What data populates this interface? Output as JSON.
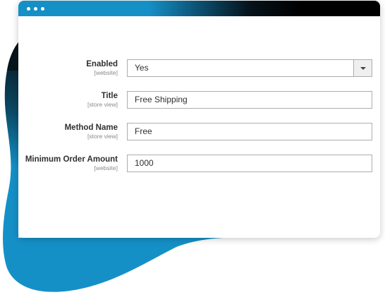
{
  "colors": {
    "accent": "#1590c7",
    "titlebar_end": "#000000",
    "label_text": "#303030",
    "scope_text": "#8a8a8a",
    "input_border": "#adadad"
  },
  "window": {
    "controls": [
      "dot",
      "dot",
      "dot"
    ]
  },
  "form": {
    "enabled": {
      "label": "Enabled",
      "scope": "[website]",
      "value": "Yes",
      "control_icon": "chevron-down-icon"
    },
    "title": {
      "label": "Title",
      "scope": "[store view]",
      "value": "Free Shipping"
    },
    "method_name": {
      "label": "Method Name",
      "scope": "[store view]",
      "value": "Free"
    },
    "minimum_order_amount": {
      "label": "Minimum Order Amount",
      "scope": "[website]",
      "value": "1000"
    }
  }
}
